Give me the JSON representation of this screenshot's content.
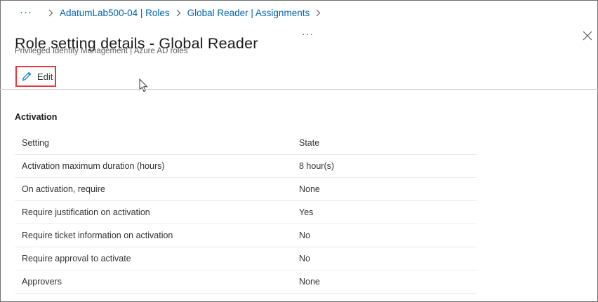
{
  "breadcrumb": {
    "ellipsis": "···",
    "items": [
      {
        "label": "AdatumLab500-04 | Roles"
      },
      {
        "label": "Global Reader | Assignments"
      }
    ]
  },
  "header": {
    "title": "Role setting details - Global Reader",
    "more": "···",
    "subtitle": "Privileged Identity Management | Azure AD roles"
  },
  "toolbar": {
    "edit_label": "Edit",
    "edit_icon": "pencil-icon",
    "highlight_color": "#e8383f"
  },
  "activation": {
    "section_title": "Activation",
    "columns": [
      "Setting",
      "State"
    ],
    "rows": [
      {
        "setting": "Activation maximum duration (hours)",
        "state": "8 hour(s)"
      },
      {
        "setting": "On activation, require",
        "state": "None"
      },
      {
        "setting": "Require justification on activation",
        "state": "Yes"
      },
      {
        "setting": "Require ticket information on activation",
        "state": "No"
      },
      {
        "setting": "Require approval to activate",
        "state": "No"
      },
      {
        "setting": "Approvers",
        "state": "None"
      }
    ]
  },
  "colors": {
    "link": "#0063b1",
    "text": "#323130",
    "muted": "#605e5c"
  }
}
